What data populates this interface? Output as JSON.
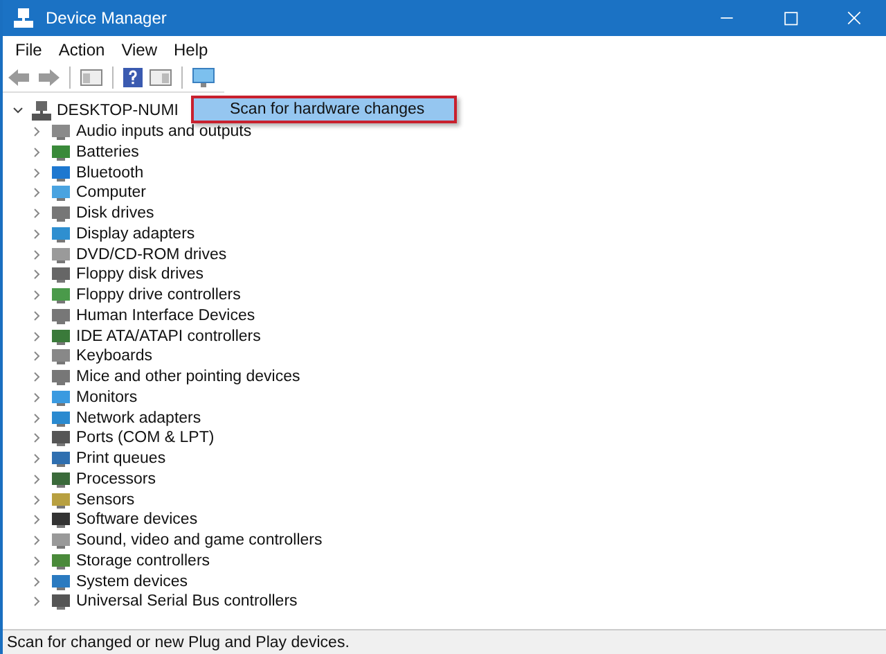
{
  "window": {
    "title": "Device Manager"
  },
  "menu_bar": [
    "File",
    "Action",
    "View",
    "Help"
  ],
  "tree": {
    "label": "DESKTOP-NUMI",
    "expanded": true,
    "children": [
      {
        "label": "Audio inputs and outputs",
        "expanded": false
      },
      {
        "label": "Batteries",
        "expanded": false
      },
      {
        "label": "Bluetooth",
        "expanded": false
      },
      {
        "label": "Computer",
        "expanded": false
      },
      {
        "label": "Disk drives",
        "expanded": false
      },
      {
        "label": "Display adapters",
        "expanded": false
      },
      {
        "label": "DVD/CD-ROM drives",
        "expanded": false
      },
      {
        "label": "Floppy disk drives",
        "expanded": false
      },
      {
        "label": "Floppy drive controllers",
        "expanded": false
      },
      {
        "label": "Human Interface Devices",
        "expanded": false
      },
      {
        "label": "IDE ATA/ATAPI controllers",
        "expanded": false
      },
      {
        "label": "Keyboards",
        "expanded": false
      },
      {
        "label": "Mice and other pointing devices",
        "expanded": false
      },
      {
        "label": "Monitors",
        "expanded": false
      },
      {
        "label": "Network adapters",
        "expanded": false
      },
      {
        "label": "Ports (COM & LPT)",
        "expanded": false
      },
      {
        "label": "Print queues",
        "expanded": false
      },
      {
        "label": "Processors",
        "expanded": false
      },
      {
        "label": "Sensors",
        "expanded": false
      },
      {
        "label": "Software devices",
        "expanded": false
      },
      {
        "label": "Sound, video and game controllers",
        "expanded": false
      },
      {
        "label": "Storage controllers",
        "expanded": false
      },
      {
        "label": "System devices",
        "expanded": false
      },
      {
        "label": "Universal Serial Bus controllers",
        "expanded": false
      }
    ]
  },
  "context_menu": {
    "items": [
      {
        "label": "Scan for hardware changes",
        "selected": true
      }
    ]
  },
  "status_bar": "Scan for changed or new Plug and Play devices."
}
